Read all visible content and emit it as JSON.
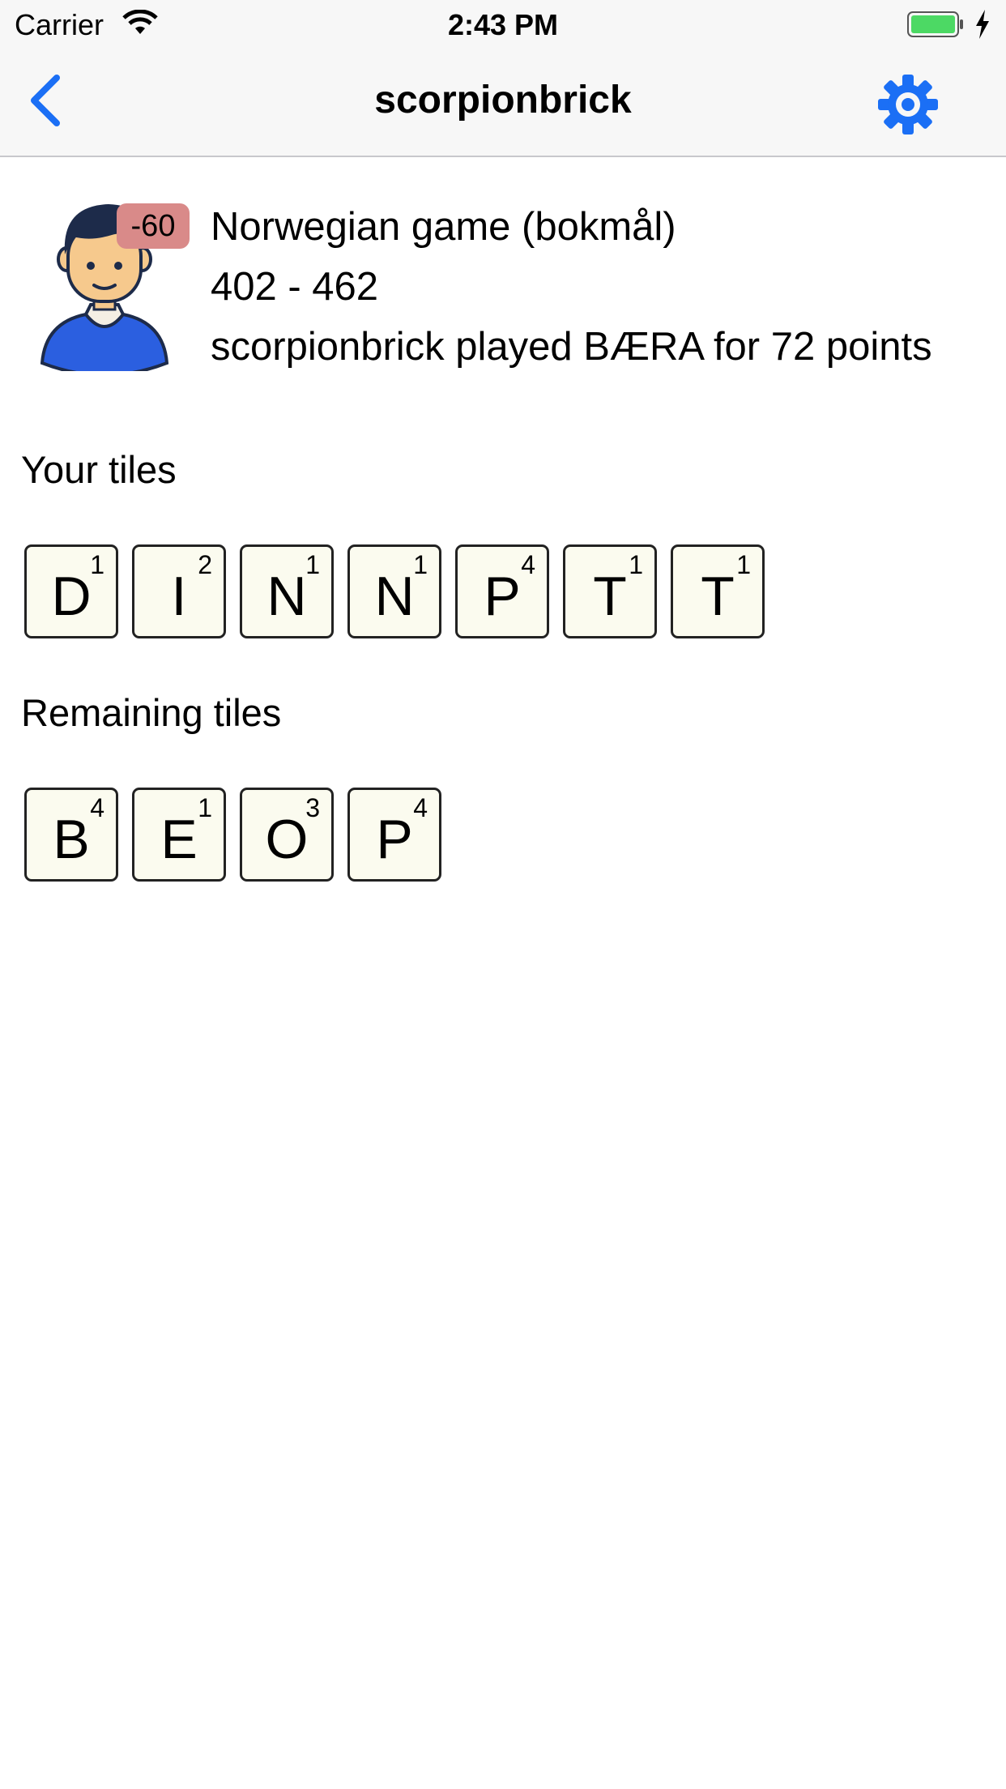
{
  "status_bar": {
    "carrier": "Carrier",
    "time": "2:43 PM"
  },
  "nav": {
    "title": "scorpionbrick",
    "back_icon": "chevron-left-icon",
    "settings_icon": "gear-icon",
    "accent": "#1b6ff5"
  },
  "header": {
    "score_delta": "-60",
    "game_title": "Norwegian game (bokmål)",
    "score": "402 - 462",
    "last_move": "scorpionbrick played BÆRA for 72 points"
  },
  "your_tiles": {
    "label": "Your tiles",
    "tiles": [
      {
        "letter": "D",
        "value": "1"
      },
      {
        "letter": "I",
        "value": "2"
      },
      {
        "letter": "N",
        "value": "1"
      },
      {
        "letter": "N",
        "value": "1"
      },
      {
        "letter": "P",
        "value": "4"
      },
      {
        "letter": "T",
        "value": "1"
      },
      {
        "letter": "T",
        "value": "1"
      }
    ]
  },
  "remaining_tiles": {
    "label": "Remaining tiles",
    "tiles": [
      {
        "letter": "B",
        "value": "4"
      },
      {
        "letter": "E",
        "value": "1"
      },
      {
        "letter": "O",
        "value": "3"
      },
      {
        "letter": "P",
        "value": "4"
      }
    ]
  }
}
